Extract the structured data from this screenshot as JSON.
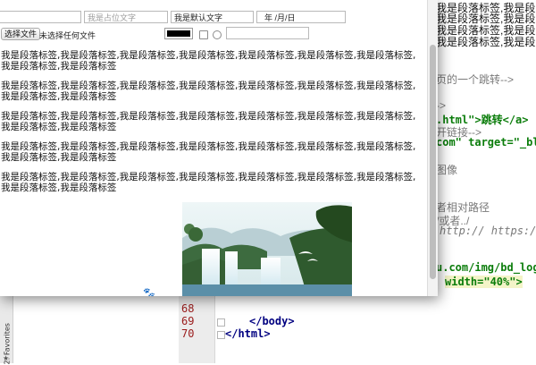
{
  "ide": {
    "favorites_tab": "2: Favorites",
    "line_numbers": [
      "68",
      "69",
      "70"
    ],
    "lines": [
      {
        "row": 0,
        "text": "我是段落标签,我是段",
        "cls": "blk"
      },
      {
        "row": 1,
        "text": "我是段落标签,我是段",
        "cls": "blk"
      },
      {
        "row": 2,
        "text": "我是段落标签,我是段",
        "cls": "blk"
      },
      {
        "row": 3,
        "text": "我是段落标签,我是段",
        "cls": "blk"
      },
      {
        "row": 4,
        "text": "页的一个跳转-->",
        "cls": "cmt"
      },
      {
        "row": 5,
        "text": "->",
        "cls": "cmt"
      },
      {
        "row": 6,
        "text": ".html\">跳转</a>",
        "cls": "str"
      },
      {
        "row": 7,
        "text": "开链接-->",
        "cls": "cmt"
      },
      {
        "row": 8,
        "text": "com\" target=\"_bl",
        "cls": "str"
      },
      {
        "row": 9,
        "text": "图像",
        "cls": "cmt"
      },
      {
        "row": 10,
        "text": "者相对路径",
        "cls": "cmt"
      },
      {
        "row": 11,
        "text": "/或者../",
        "cls": "cmt"
      },
      {
        "row": 12,
        "text": "http:// https:/",
        "cls": "url"
      },
      {
        "row": 13,
        "text": "u.com/img/bd_log",
        "cls": "str"
      },
      {
        "row": 14,
        "text": "width=\"40%\">",
        "cls": "str"
      }
    ],
    "closing_body": "</body>",
    "closing_html": "</html>"
  },
  "form": {
    "text_input_1_value": "",
    "placeholder_input": "我是占位文字",
    "default_input_value": "我是默认文字",
    "date_input": "年 /月/日",
    "file_button_label": "选择文件",
    "file_status": "未选择任何文件",
    "color_value": "#000000",
    "text_input_2_value": ""
  },
  "paragraph_text": "我是段落标签,我是段落标签,我是段落标签,我是段落标签,我是段落标签,我是段落标签,我是段落标签,我是段落标签,我是段落标签",
  "paragraph_count": 5,
  "image_caption_icon": "baidu-paw-icon"
}
